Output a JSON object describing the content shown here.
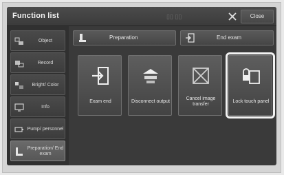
{
  "window": {
    "title": "Function list",
    "title_glyphs": "▯▯ ▯▯",
    "close_label": "Close",
    "close_icon": "x-icon"
  },
  "sidebar": {
    "items": [
      {
        "label": "Object",
        "icon": "object-icon",
        "active": false
      },
      {
        "label": "Record",
        "icon": "record-icon",
        "active": false
      },
      {
        "label": "Bright/ Color",
        "icon": "brightness-icon",
        "active": false
      },
      {
        "label": "Info",
        "icon": "monitor-icon",
        "active": false
      },
      {
        "label": "Pump/ personnel",
        "icon": "pump-icon",
        "active": false
      },
      {
        "label": "Preparation/ End exam",
        "icon": "preparation-icon",
        "active": true
      }
    ]
  },
  "toolbar": {
    "preparation_label": "Preparation",
    "end_exam_label": "End exam"
  },
  "tiles": [
    {
      "label": "Exam end",
      "icon": "exit-door-icon",
      "highlighted": false
    },
    {
      "label": "Disconnect output",
      "icon": "disconnect-icon",
      "highlighted": false
    },
    {
      "label": "Cancel image transfer",
      "icon": "cancel-transfer-icon",
      "highlighted": false
    },
    {
      "label": "Lock touch panel",
      "icon": "lock-touch-icon",
      "highlighted": true
    }
  ],
  "colors": {
    "screen_bg": "#3a3a3a",
    "button_bg": "#4a4a4a",
    "text": "#e8e8e8",
    "highlight_outline": "#f2f2f2"
  }
}
